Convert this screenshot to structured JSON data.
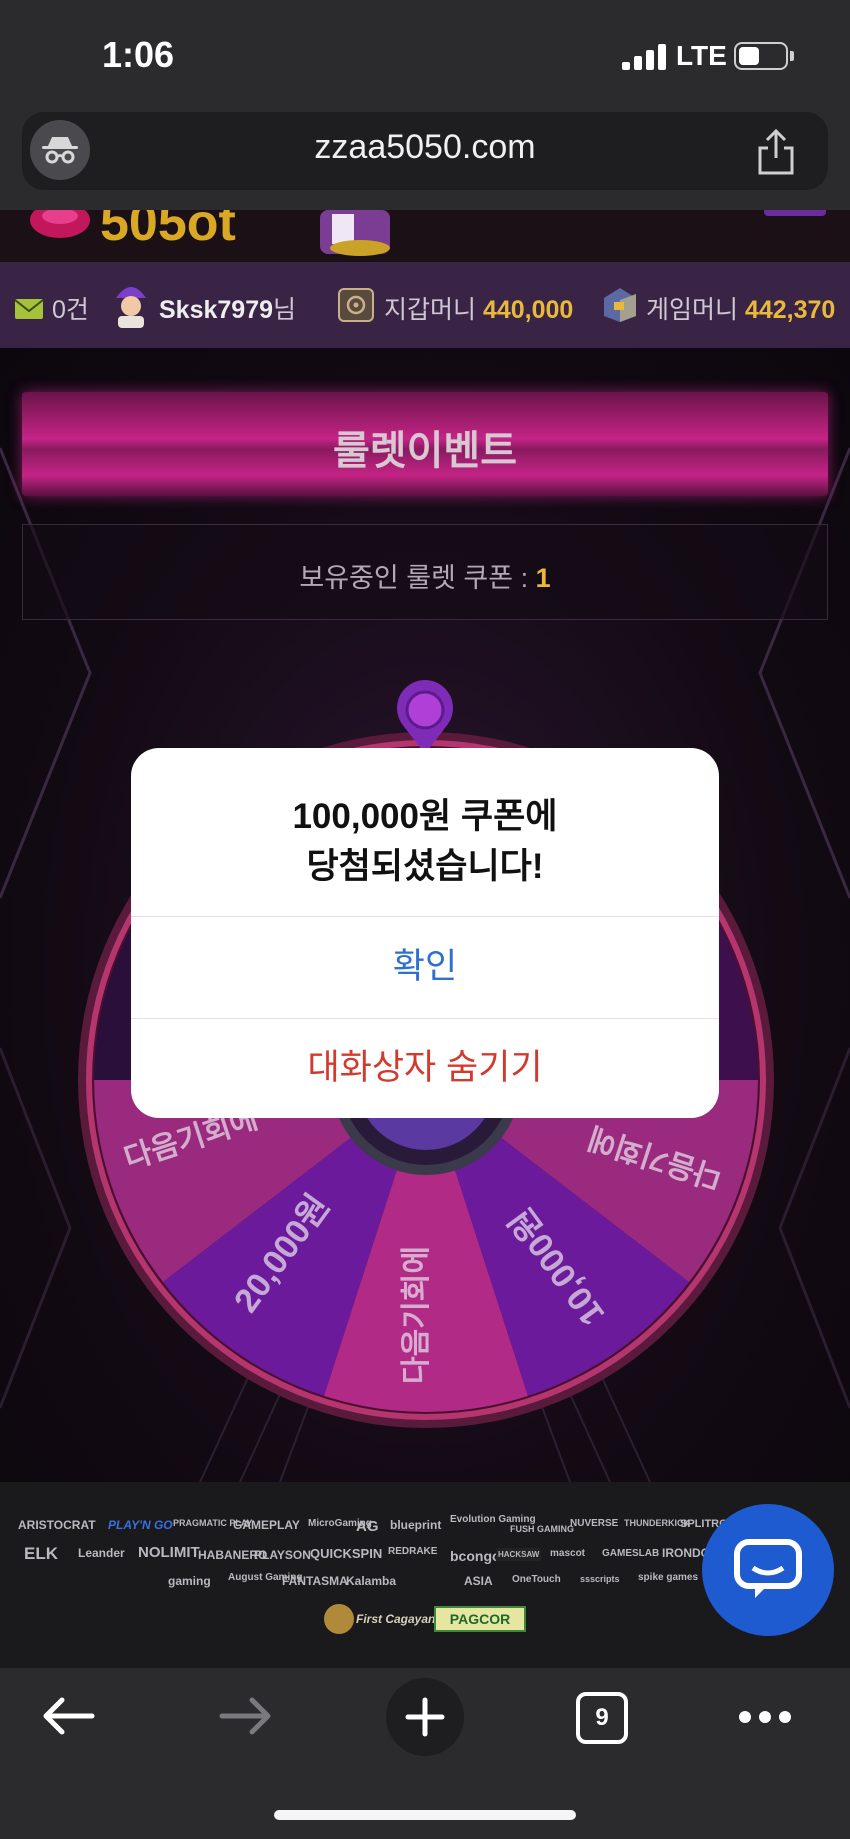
{
  "status_bar": {
    "time": "1:06",
    "network": "LTE"
  },
  "browser": {
    "url": "zzaa5050.com",
    "tab_count": "9",
    "icons": {
      "incognito": "incognito-icon",
      "share": "share-icon",
      "back": "back-arrow-icon",
      "forward": "forward-arrow-icon",
      "new_tab": "plus-icon",
      "more": "more-dots-icon"
    }
  },
  "userbar": {
    "messages": "0건",
    "username": "Sksk7979",
    "username_suffix": "님",
    "wallet_label": "지갑머니",
    "wallet_value": "440,000",
    "game_label": "게임머니",
    "game_value": "442,370"
  },
  "event": {
    "title": "룰렛이벤트",
    "coupon_label": "보유중인 룰렛 쿠폰 : ",
    "coupon_count": "1"
  },
  "wheel": {
    "segments": [
      "다음기회에",
      "20,000원",
      "다음기회에",
      "10,000원",
      "다음기회에"
    ]
  },
  "dialog": {
    "message_line1": "100,000원 쿠폰에",
    "message_line2": "당첨되셨습니다!",
    "ok_label": "확인",
    "hide_label": "대화상자 숨기기"
  },
  "footer": {
    "partners": [
      "ARISTOCRAT",
      "PLAY'N GO",
      "PRAGMATIC PLAY",
      "GAMEPLAY",
      "MicroGaming",
      "AG",
      "blueprint",
      "Evolution Gaming",
      "FUSH GAMING",
      "NUVERSE",
      "THUNDERKICK",
      "SPLITROCK",
      "ELK",
      "Leander",
      "NOLIMIT",
      "HABANERO",
      "PLAYSON",
      "QUICKSPIN",
      "REDRAKE",
      "bcongo",
      "HACKSAW",
      "mascot",
      "GAMESLAB",
      "IRONDOG",
      "gaming",
      "August Gaming",
      "FANTASMA",
      "Kalamba",
      "ASIA",
      "OneTouch",
      "ssscripts",
      "spike games"
    ],
    "cert1": "First Cagayan",
    "cert2": "PAGCOR"
  },
  "colors": {
    "accent_gold": "#e8b93a",
    "banner_pink": "#c42486",
    "dialog_ok": "#2e6fd0",
    "dialog_hide": "#d33a2f",
    "chat_blue": "#1f5bd0"
  }
}
